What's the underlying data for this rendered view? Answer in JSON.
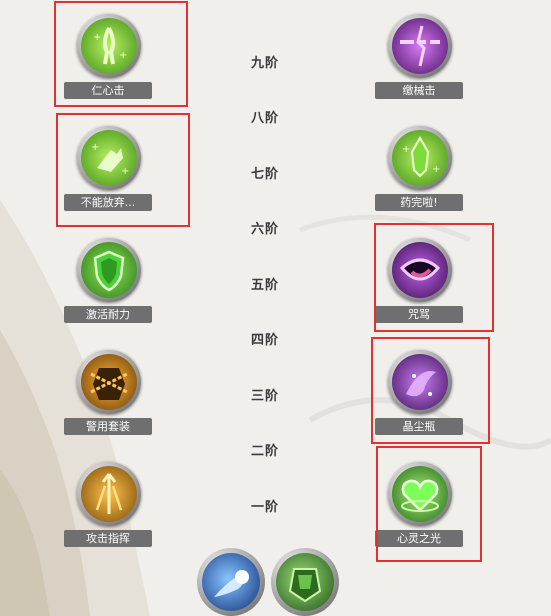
{
  "tiers": [
    "九阶",
    "八阶",
    "七阶",
    "六阶",
    "五阶",
    "四阶",
    "三阶",
    "二阶",
    "一阶"
  ],
  "left_skills": [
    {
      "label": "仁心击",
      "icon": "healing-hand-icon",
      "color": "#7fcf2a"
    },
    {
      "label": "不能放弃...",
      "icon": "praying-hands-icon",
      "color": "#7fcf2a"
    },
    {
      "label": "激活耐力",
      "icon": "shield-icon",
      "color": "#58c23a"
    },
    {
      "label": "警用套装",
      "icon": "chained-armor-icon",
      "color": "#d98a14"
    },
    {
      "label": "攻击指挥",
      "icon": "arrows-command-icon",
      "color": "#d98a14"
    }
  ],
  "right_skills": [
    {
      "label": "缴械击",
      "icon": "broken-chain-icon",
      "color": "#b04ad8"
    },
    {
      "label": "药完啦!",
      "icon": "empty-potion-icon",
      "color": "#7fcf2a"
    },
    {
      "label": "咒骂",
      "icon": "cursing-mouth-icon",
      "color": "#9c3fc4"
    },
    {
      "label": "晶尘瓶",
      "icon": "dust-bottle-icon",
      "color": "#9c3fc4"
    },
    {
      "label": "心灵之光",
      "icon": "heart-light-icon",
      "color": "#5fd23a"
    }
  ],
  "bottom_icons": [
    {
      "icon": "blue-comet-icon",
      "color": "#2266d8"
    },
    {
      "icon": "green-armor-icon",
      "color": "#4aa63a"
    }
  ],
  "accent_color": "#e23131"
}
